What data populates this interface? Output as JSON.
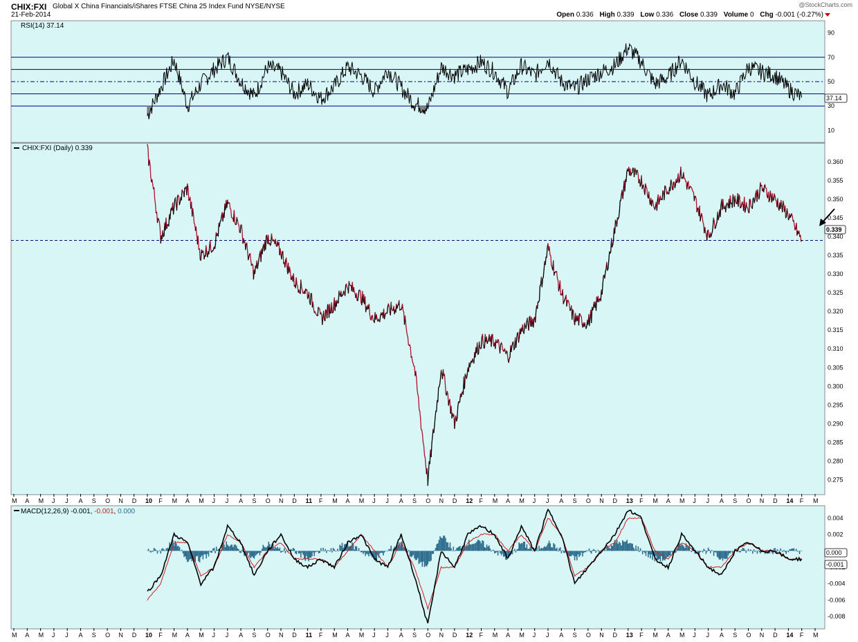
{
  "header": {
    "symbol": "CHIX:FXI",
    "name": "Global X China Financials/iShares FTSE China 25 Index Fund NYSE/NYSE",
    "date": "21-Feb-2014",
    "brand": "@StockCharts.com",
    "open_label": "Open",
    "open": "0.336",
    "high_label": "High",
    "high": "0.339",
    "low_label": "Low",
    "low": "0.336",
    "close_label": "Close",
    "close": "0.339",
    "volume_label": "Volume",
    "volume": "0",
    "chg_label": "Chg",
    "chg": "-0.001 (-0.27%)"
  },
  "colors": {
    "panel_bg": "#d8f6f6",
    "rsi_line": "#000000",
    "rsi_fill": "#808080",
    "guide_line": "#00007a",
    "price_up": "#000000",
    "price_down": "#b0102a",
    "macd_line": "#000000",
    "signal_line": "#cc2020",
    "histogram": "#2f6e8e",
    "arrow": "#000000"
  },
  "chart_data": [
    {
      "type": "line",
      "panel": "rsi",
      "legend": "RSI(14) 37.14",
      "last_value": "37.14",
      "ylim": [
        0,
        100
      ],
      "yticks": [
        "90",
        "70",
        "50",
        "30",
        "10"
      ],
      "guides": [
        30,
        40,
        50,
        60,
        70
      ],
      "x": [
        "2010-01",
        "2010-02",
        "2010-03",
        "2010-04",
        "2010-05",
        "2010-06",
        "2010-07",
        "2010-08",
        "2010-09",
        "2010-10",
        "2010-11",
        "2010-12",
        "2011-01",
        "2011-02",
        "2011-03",
        "2011-04",
        "2011-05",
        "2011-06",
        "2011-07",
        "2011-08",
        "2011-09",
        "2011-10",
        "2011-11",
        "2011-12",
        "2012-01",
        "2012-02",
        "2012-03",
        "2012-04",
        "2012-05",
        "2012-06",
        "2012-07",
        "2012-08",
        "2012-09",
        "2012-10",
        "2012-11",
        "2012-12",
        "2013-01",
        "2013-02",
        "2013-03",
        "2013-04",
        "2013-05",
        "2013-06",
        "2013-07",
        "2013-08",
        "2013-09",
        "2013-10",
        "2013-11",
        "2013-12",
        "2014-01",
        "2014-02"
      ],
      "values": [
        22,
        45,
        68,
        30,
        48,
        60,
        70,
        50,
        38,
        62,
        58,
        40,
        48,
        36,
        46,
        62,
        55,
        42,
        60,
        45,
        32,
        28,
        62,
        55,
        60,
        66,
        58,
        42,
        63,
        55,
        68,
        50,
        44,
        52,
        58,
        63,
        78,
        66,
        48,
        54,
        68,
        50,
        38,
        48,
        40,
        62,
        58,
        55,
        44,
        37
      ]
    },
    {
      "type": "line",
      "panel": "price",
      "legend": "CHIX:FXI (Daily) 0.339",
      "last_value": "0.339",
      "ylim": [
        0.271,
        0.365
      ],
      "yticks": [
        "0.360",
        "0.355",
        "0.350",
        "0.345",
        "0.340",
        "0.335",
        "0.330",
        "0.325",
        "0.320",
        "0.315",
        "0.310",
        "0.305",
        "0.300",
        "0.295",
        "0.290",
        "0.285",
        "0.280",
        "0.275"
      ],
      "reference_line": 0.339,
      "x": [
        "2010-01",
        "2010-02",
        "2010-03",
        "2010-04",
        "2010-05",
        "2010-06",
        "2010-07",
        "2010-08",
        "2010-09",
        "2010-10",
        "2010-11",
        "2010-12",
        "2011-01",
        "2011-02",
        "2011-03",
        "2011-04",
        "2011-05",
        "2011-06",
        "2011-07",
        "2011-08",
        "2011-09",
        "2011-10",
        "2011-11",
        "2011-12",
        "2012-01",
        "2012-02",
        "2012-03",
        "2012-04",
        "2012-05",
        "2012-06",
        "2012-07",
        "2012-08",
        "2012-09",
        "2012-10",
        "2012-11",
        "2012-12",
        "2013-01",
        "2013-02",
        "2013-03",
        "2013-04",
        "2013-05",
        "2013-06",
        "2013-07",
        "2013-08",
        "2013-09",
        "2013-10",
        "2013-11",
        "2013-12",
        "2014-01",
        "2014-02"
      ],
      "values": [
        0.363,
        0.34,
        0.348,
        0.353,
        0.335,
        0.338,
        0.349,
        0.342,
        0.33,
        0.34,
        0.336,
        0.328,
        0.325,
        0.318,
        0.322,
        0.327,
        0.324,
        0.318,
        0.32,
        0.322,
        0.305,
        0.275,
        0.305,
        0.29,
        0.305,
        0.312,
        0.312,
        0.308,
        0.315,
        0.318,
        0.337,
        0.325,
        0.318,
        0.317,
        0.325,
        0.342,
        0.358,
        0.355,
        0.348,
        0.353,
        0.357,
        0.35,
        0.34,
        0.348,
        0.35,
        0.348,
        0.353,
        0.35,
        0.346,
        0.339
      ]
    },
    {
      "type": "line",
      "panel": "macd",
      "legend": "MACD(12,26,9)",
      "legend_macd": "-0.001",
      "legend_signal": "-0.001",
      "legend_hist": "0.000",
      "ylim": [
        -0.0095,
        0.0055
      ],
      "yticks": [
        "0.004",
        "0.002",
        "0.000",
        "-0.002",
        "-0.004",
        "-0.006",
        "-0.008"
      ],
      "box_labels": [
        "0.000",
        "-0.001"
      ],
      "x": [
        "2010-01",
        "2010-02",
        "2010-03",
        "2010-04",
        "2010-05",
        "2010-06",
        "2010-07",
        "2010-08",
        "2010-09",
        "2010-10",
        "2010-11",
        "2010-12",
        "2011-01",
        "2011-02",
        "2011-03",
        "2011-04",
        "2011-05",
        "2011-06",
        "2011-07",
        "2011-08",
        "2011-09",
        "2011-10",
        "2011-11",
        "2011-12",
        "2012-01",
        "2012-02",
        "2012-03",
        "2012-04",
        "2012-05",
        "2012-06",
        "2012-07",
        "2012-08",
        "2012-09",
        "2012-10",
        "2012-11",
        "2012-12",
        "2013-01",
        "2013-02",
        "2013-03",
        "2013-04",
        "2013-05",
        "2013-06",
        "2013-07",
        "2013-08",
        "2013-09",
        "2013-10",
        "2013-11",
        "2013-12",
        "2014-01",
        "2014-02"
      ],
      "series": [
        {
          "values": [
            -0.005,
            -0.003,
            0.002,
            0.001,
            -0.004,
            -0.002,
            0.003,
            0.001,
            -0.003,
            0.0,
            0.002,
            -0.001,
            -0.002,
            -0.001,
            -0.002,
            0.001,
            0.002,
            -0.001,
            -0.002,
            0.002,
            -0.003,
            -0.009,
            0.0,
            -0.002,
            0.002,
            0.003,
            0.002,
            -0.001,
            0.003,
            0.0,
            0.005,
            0.002,
            -0.004,
            -0.002,
            0.0,
            0.002,
            0.005,
            0.004,
            -0.001,
            -0.002,
            0.002,
            0.0,
            -0.002,
            -0.003,
            0.0,
            0.001,
            0.0,
            0.0,
            -0.001,
            -0.001
          ]
        },
        {
          "values": [
            -0.006,
            -0.004,
            0.001,
            0.001,
            -0.003,
            -0.002,
            0.002,
            0.001,
            -0.002,
            0.0,
            0.001,
            -0.001,
            -0.001,
            -0.001,
            -0.002,
            0.0,
            0.002,
            0.0,
            -0.002,
            0.001,
            -0.002,
            -0.007,
            -0.002,
            -0.002,
            0.001,
            0.002,
            0.002,
            0.0,
            0.002,
            0.0,
            0.004,
            0.002,
            -0.003,
            -0.002,
            0.0,
            0.001,
            0.004,
            0.004,
            0.0,
            -0.001,
            0.001,
            0.0,
            -0.002,
            -0.002,
            0.0,
            0.001,
            0.0,
            0.0,
            -0.001,
            -0.001
          ]
        }
      ],
      "histogram": [
        0.0,
        0.0,
        0.001,
        -0.001,
        -0.001,
        0.0,
        0.001,
        0.0,
        -0.001,
        0.001,
        0.0,
        0.0,
        -0.001,
        0.0,
        0.0,
        0.001,
        0.0,
        -0.001,
        0.0,
        0.001,
        -0.001,
        -0.002,
        0.002,
        0.0,
        0.001,
        0.001,
        0.0,
        -0.001,
        0.001,
        0.0,
        0.001,
        0.0,
        -0.001,
        0.0,
        0.0,
        0.001,
        0.001,
        0.0,
        -0.001,
        -0.001,
        0.001,
        0.0,
        0.0,
        -0.001,
        0.0,
        0.0,
        0.0,
        0.0,
        0.0,
        0.0
      ]
    }
  ],
  "x_axis": {
    "labels": [
      "M",
      "A",
      "M",
      "J",
      "J",
      "A",
      "S",
      "O",
      "N",
      "D",
      "10",
      "F",
      "M",
      "A",
      "M",
      "J",
      "J",
      "A",
      "S",
      "O",
      "N",
      "D",
      "11",
      "F",
      "M",
      "A",
      "M",
      "J",
      "J",
      "A",
      "S",
      "O",
      "N",
      "D",
      "12",
      "F",
      "M",
      "A",
      "M",
      "J",
      "J",
      "A",
      "S",
      "O",
      "N",
      "D",
      "13",
      "F",
      "M",
      "A",
      "M",
      "J",
      "J",
      "A",
      "S",
      "O",
      "N",
      "D",
      "14",
      "F",
      "M"
    ]
  }
}
